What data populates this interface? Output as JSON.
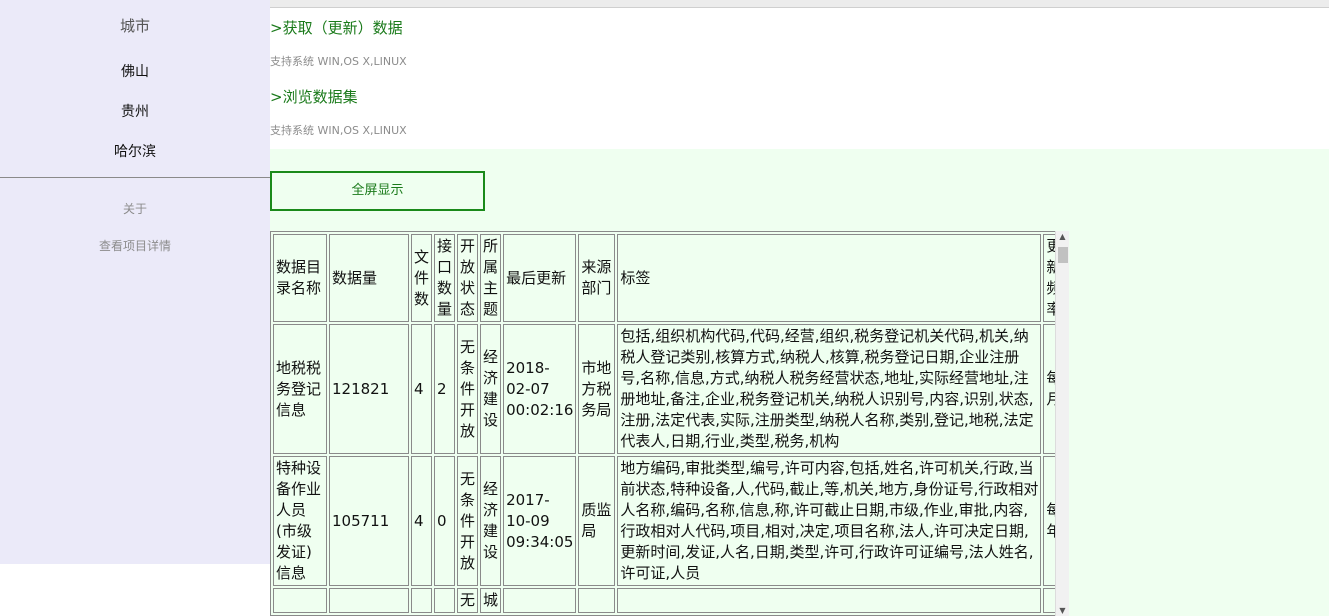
{
  "sidebar": {
    "title": "城市",
    "cities": [
      "佛山",
      "贵州",
      "哈尔滨"
    ],
    "about": "关于",
    "details": "查看项目详情"
  },
  "sections": [
    {
      "title": ">获取（更新）数据",
      "subtitle": "支持系统 WIN,OS X,LINUX"
    },
    {
      "title": ">浏览数据集",
      "subtitle": "支持系统 WIN,OS X,LINUX"
    }
  ],
  "fullscreen_label": "全屏显示",
  "table": {
    "headers": [
      "数据目录名称",
      "数据量",
      "文件数",
      "接口数量",
      "开放状态",
      "所属主题",
      "最后更新",
      "来源部门",
      "标签",
      "更新频率"
    ],
    "rows": [
      [
        "地税税务登记信息",
        "121821",
        "4",
        "2",
        "无条件开放",
        "经济建设",
        "2018-02-07 00:02:16",
        "市地方税务局",
        "包括,组织机构代码,代码,经营,组织,税务登记机关代码,机关,纳税人登记类别,核算方式,纳税人,核算,税务登记日期,企业注册号,名称,信息,方式,纳税人税务经营状态,地址,实际经营地址,注册地址,备注,企业,税务登记机关,纳税人识别号,内容,识别,状态,注册,法定代表,实际,注册类型,纳税人名称,类别,登记,地税,法定代表人,日期,行业,类型,税务,机构",
        "每月"
      ],
      [
        "特种设备作业人员(市级发证)信息",
        "105711",
        "4",
        "0",
        "无条件开放",
        "经济建设",
        "2017-10-09 09:34:05",
        "质监局",
        "地方编码,审批类型,编号,许可内容,包括,姓名,许可机关,行政,当前状态,特种设备,人,代码,截止,等,机关,地方,身份证号,行政相对人名称,编码,名称,信息,称,许可截止日期,市级,作业,审批,内容,行政相对人代码,项目,相对,决定,项目名称,法人,许可决定日期,更新时间,发证,人名,日期,类型,许可,行政许可证编号,法人姓名,许可证,人员",
        "每年"
      ],
      [
        "",
        "",
        "",
        "",
        "无",
        "城",
        "",
        "",
        "",
        ""
      ]
    ]
  }
}
